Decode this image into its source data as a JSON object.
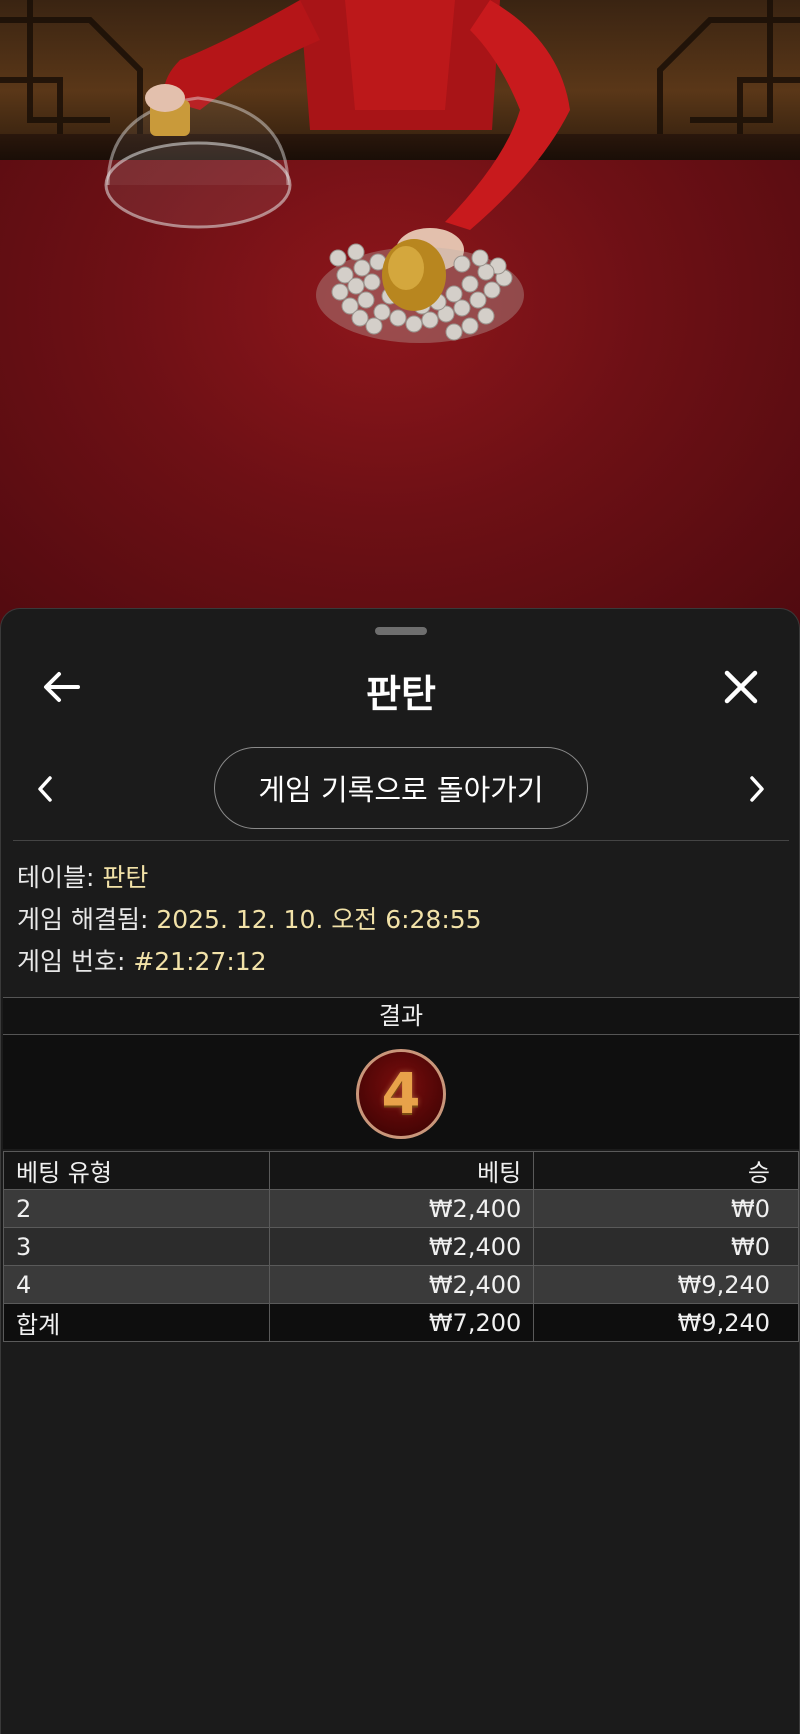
{
  "sheet": {
    "title": "판탄",
    "back_button_label": "게임 기록으로 돌아가기"
  },
  "info": {
    "table_label": "테이블: ",
    "table_value": "판탄",
    "resolved_label": "게임 해결됨: ",
    "resolved_value": "2025. 12. 10. 오전 6:28:55",
    "game_no_label": "게임 번호: ",
    "game_no_value": "#21:27:12"
  },
  "result": {
    "header": "결과",
    "value": "4"
  },
  "bets": {
    "headers": [
      "베팅 유형",
      "베팅",
      "승"
    ],
    "rows": [
      {
        "type": "2",
        "bet": "₩2,400",
        "win": "₩0"
      },
      {
        "type": "3",
        "bet": "₩2,400",
        "win": "₩0"
      },
      {
        "type": "4",
        "bet": "₩2,400",
        "win": "₩9,240"
      }
    ],
    "total": {
      "type": "합계",
      "bet": "₩7,200",
      "win": "₩9,240"
    }
  },
  "icons": {
    "back": "arrow-left-icon",
    "close": "close-icon",
    "prev": "chevron-left-icon",
    "next": "chevron-right-icon"
  },
  "colors": {
    "sheet_bg": "#1b1b1b",
    "info_value": "#f2e2a8",
    "felt": "#6d1015",
    "dice_digit": "#e8a24a"
  }
}
